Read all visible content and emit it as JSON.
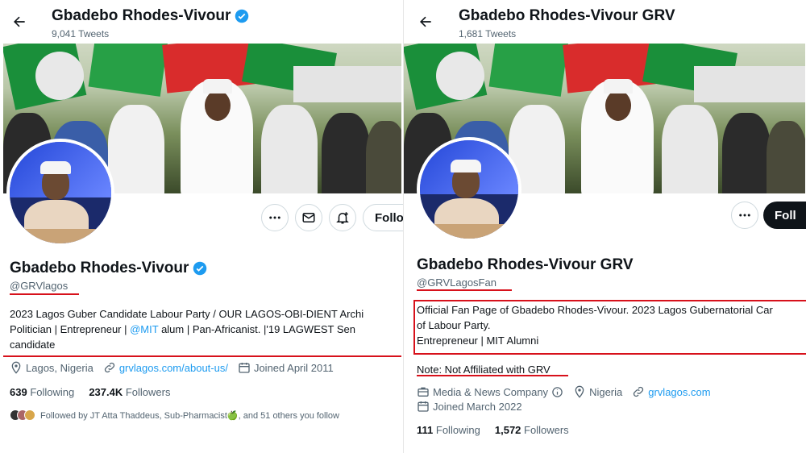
{
  "left": {
    "header": {
      "name": "Gbadebo Rhodes-Vivour",
      "tweet_count": "9,041 Tweets"
    },
    "profile": {
      "name": "Gbadebo Rhodes-Vivour",
      "handle": "@GRVlagos",
      "bio_line1": "2023 Lagos Guber Candidate Labour Party / OUR LAGOS-OBI-DIENT Archi",
      "bio_line2_a": "Politician | Entrepreneur | ",
      "bio_line2_link": "@MIT",
      "bio_line2_b": " alum | Pan-Africanist. |'19 LAGWEST Sen",
      "bio_line3": "candidate",
      "location": "Lagos, Nigeria",
      "website": "grvlagos.com/about-us/",
      "joined": "Joined April 2011",
      "following_count": "639",
      "following_label": "Following",
      "followers_count": "237.4K",
      "followers_label": "Followers",
      "followed_by": "Followed by JT Atta Thaddeus, Sub-Pharmacist🍏, and 51 others you follow"
    },
    "follow_label": "Follo"
  },
  "right": {
    "header": {
      "name": "Gbadebo Rhodes-Vivour GRV",
      "tweet_count": "1,681 Tweets"
    },
    "profile": {
      "name": "Gbadebo Rhodes-Vivour GRV",
      "handle": "@GRVLagosFan",
      "bio_line1": "Official Fan Page of Gbadebo Rhodes-Vivour. 2023 Lagos Gubernatorial Car",
      "bio_line2": "of Labour Party.",
      "bio_line3": "Entrepreneur | MIT Alumni",
      "note": "Note: Not Affiliated with GRV",
      "category": "Media & News Company",
      "location": "Nigeria",
      "website": "grvlagos.com",
      "joined": "Joined March 2022",
      "following_count": "111",
      "following_label": "Following",
      "followers_count": "1,572",
      "followers_label": "Followers"
    },
    "follow_label": "Foll"
  },
  "colors": {
    "verified": "#1d9bf0",
    "highlight": "#d7111b",
    "link": "#1d9bf0"
  },
  "icons": [
    "back-arrow-icon",
    "verified-badge-icon",
    "more-icon",
    "message-icon",
    "notification-bell-icon",
    "location-icon",
    "link-icon",
    "calendar-icon",
    "briefcase-icon",
    "info-icon"
  ]
}
